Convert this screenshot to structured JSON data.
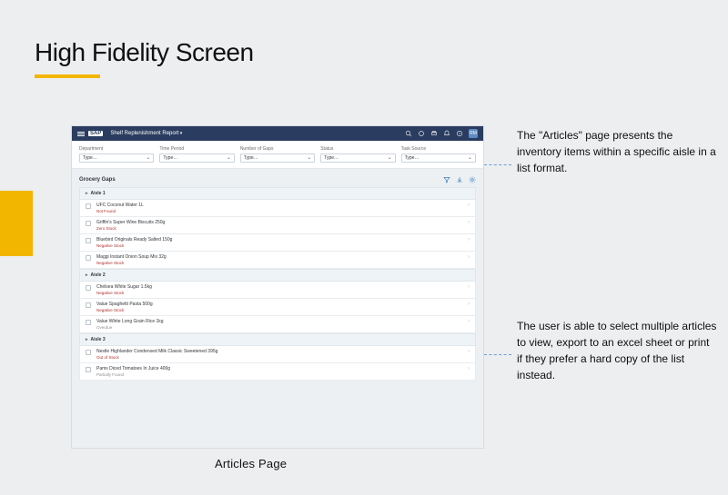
{
  "slide": {
    "title": "High Fidelity Screen",
    "caption": "Articles Page"
  },
  "annotations": {
    "a1": "The \"Articles\" page presents the inventory items within a specific aisle in a list format.",
    "a2": "The user is able to select multiple articles to view, export to an excel sheet or print if they prefer a hard copy of the list instead."
  },
  "shellbar": {
    "logo": "SAP",
    "title": "Shelf Replenishment Report",
    "avatar": "RM"
  },
  "filters": [
    {
      "label": "Department",
      "value": "Type…"
    },
    {
      "label": "Time Period",
      "value": "Type…"
    },
    {
      "label": "Number of Gaps",
      "value": "Type…"
    },
    {
      "label": "Status",
      "value": "Type…"
    },
    {
      "label": "Task Source",
      "value": "Type…"
    }
  ],
  "section": {
    "title": "Grocery Gaps"
  },
  "aisles": [
    {
      "name": "Aisle 1",
      "rows": [
        {
          "title": "UFC Coconut Water 1L",
          "status": "Not Found",
          "subclass": ""
        },
        {
          "title": "Griffin's Super Wine Biscuits 250g",
          "status": "Zero Stock",
          "subclass": ""
        },
        {
          "title": "Bluebird Originals Ready Salted 150g",
          "status": "Negative Stock",
          "subclass": ""
        },
        {
          "title": "Maggi Instant Onion Soup Mix 32g",
          "status": "Negative Stock",
          "subclass": ""
        }
      ]
    },
    {
      "name": "Aisle 2",
      "rows": [
        {
          "title": "Chelsea White Sugar 1.5kg",
          "status": "Negative Stock",
          "subclass": ""
        },
        {
          "title": "Value Spaghetti Pasta 500g",
          "status": "Negative Stock",
          "subclass": ""
        },
        {
          "title": "Value White Long Grain Rice 1kg",
          "status": "Overdue",
          "subclass": "grey"
        }
      ]
    },
    {
      "name": "Aisle 3",
      "rows": [
        {
          "title": "Nestle Highlander Condensed Milk Classic Sweetened 395g",
          "status": "Out of Stock",
          "subclass": ""
        },
        {
          "title": "Pams Diced Tomatoes In Juice 400g",
          "status": "Partially Found",
          "subclass": "grey"
        }
      ]
    }
  ]
}
